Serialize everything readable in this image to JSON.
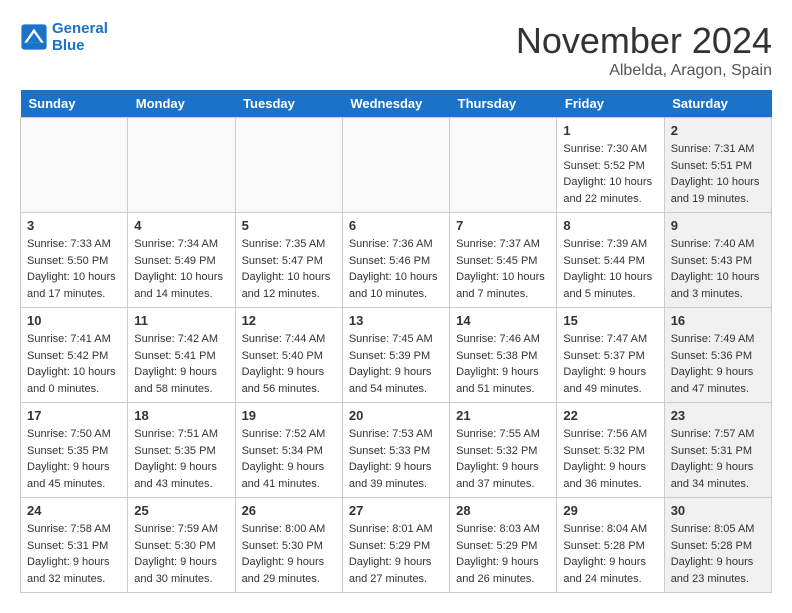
{
  "logo": {
    "line1": "General",
    "line2": "Blue"
  },
  "title": "November 2024",
  "location": "Albelda, Aragon, Spain",
  "days_of_week": [
    "Sunday",
    "Monday",
    "Tuesday",
    "Wednesday",
    "Thursday",
    "Friday",
    "Saturday"
  ],
  "weeks": [
    [
      {
        "day": "",
        "info": "",
        "empty": true
      },
      {
        "day": "",
        "info": "",
        "empty": true
      },
      {
        "day": "",
        "info": "",
        "empty": true
      },
      {
        "day": "",
        "info": "",
        "empty": true
      },
      {
        "day": "",
        "info": "",
        "empty": true
      },
      {
        "day": "1",
        "info": "Sunrise: 7:30 AM\nSunset: 5:52 PM\nDaylight: 10 hours\nand 22 minutes.",
        "empty": false,
        "shaded": false
      },
      {
        "day": "2",
        "info": "Sunrise: 7:31 AM\nSunset: 5:51 PM\nDaylight: 10 hours\nand 19 minutes.",
        "empty": false,
        "shaded": true
      }
    ],
    [
      {
        "day": "3",
        "info": "Sunrise: 7:33 AM\nSunset: 5:50 PM\nDaylight: 10 hours\nand 17 minutes.",
        "empty": false,
        "shaded": false
      },
      {
        "day": "4",
        "info": "Sunrise: 7:34 AM\nSunset: 5:49 PM\nDaylight: 10 hours\nand 14 minutes.",
        "empty": false,
        "shaded": false
      },
      {
        "day": "5",
        "info": "Sunrise: 7:35 AM\nSunset: 5:47 PM\nDaylight: 10 hours\nand 12 minutes.",
        "empty": false,
        "shaded": false
      },
      {
        "day": "6",
        "info": "Sunrise: 7:36 AM\nSunset: 5:46 PM\nDaylight: 10 hours\nand 10 minutes.",
        "empty": false,
        "shaded": false
      },
      {
        "day": "7",
        "info": "Sunrise: 7:37 AM\nSunset: 5:45 PM\nDaylight: 10 hours\nand 7 minutes.",
        "empty": false,
        "shaded": false
      },
      {
        "day": "8",
        "info": "Sunrise: 7:39 AM\nSunset: 5:44 PM\nDaylight: 10 hours\nand 5 minutes.",
        "empty": false,
        "shaded": false
      },
      {
        "day": "9",
        "info": "Sunrise: 7:40 AM\nSunset: 5:43 PM\nDaylight: 10 hours\nand 3 minutes.",
        "empty": false,
        "shaded": true
      }
    ],
    [
      {
        "day": "10",
        "info": "Sunrise: 7:41 AM\nSunset: 5:42 PM\nDaylight: 10 hours\nand 0 minutes.",
        "empty": false,
        "shaded": false
      },
      {
        "day": "11",
        "info": "Sunrise: 7:42 AM\nSunset: 5:41 PM\nDaylight: 9 hours\nand 58 minutes.",
        "empty": false,
        "shaded": false
      },
      {
        "day": "12",
        "info": "Sunrise: 7:44 AM\nSunset: 5:40 PM\nDaylight: 9 hours\nand 56 minutes.",
        "empty": false,
        "shaded": false
      },
      {
        "day": "13",
        "info": "Sunrise: 7:45 AM\nSunset: 5:39 PM\nDaylight: 9 hours\nand 54 minutes.",
        "empty": false,
        "shaded": false
      },
      {
        "day": "14",
        "info": "Sunrise: 7:46 AM\nSunset: 5:38 PM\nDaylight: 9 hours\nand 51 minutes.",
        "empty": false,
        "shaded": false
      },
      {
        "day": "15",
        "info": "Sunrise: 7:47 AM\nSunset: 5:37 PM\nDaylight: 9 hours\nand 49 minutes.",
        "empty": false,
        "shaded": false
      },
      {
        "day": "16",
        "info": "Sunrise: 7:49 AM\nSunset: 5:36 PM\nDaylight: 9 hours\nand 47 minutes.",
        "empty": false,
        "shaded": true
      }
    ],
    [
      {
        "day": "17",
        "info": "Sunrise: 7:50 AM\nSunset: 5:35 PM\nDaylight: 9 hours\nand 45 minutes.",
        "empty": false,
        "shaded": false
      },
      {
        "day": "18",
        "info": "Sunrise: 7:51 AM\nSunset: 5:35 PM\nDaylight: 9 hours\nand 43 minutes.",
        "empty": false,
        "shaded": false
      },
      {
        "day": "19",
        "info": "Sunrise: 7:52 AM\nSunset: 5:34 PM\nDaylight: 9 hours\nand 41 minutes.",
        "empty": false,
        "shaded": false
      },
      {
        "day": "20",
        "info": "Sunrise: 7:53 AM\nSunset: 5:33 PM\nDaylight: 9 hours\nand 39 minutes.",
        "empty": false,
        "shaded": false
      },
      {
        "day": "21",
        "info": "Sunrise: 7:55 AM\nSunset: 5:32 PM\nDaylight: 9 hours\nand 37 minutes.",
        "empty": false,
        "shaded": false
      },
      {
        "day": "22",
        "info": "Sunrise: 7:56 AM\nSunset: 5:32 PM\nDaylight: 9 hours\nand 36 minutes.",
        "empty": false,
        "shaded": false
      },
      {
        "day": "23",
        "info": "Sunrise: 7:57 AM\nSunset: 5:31 PM\nDaylight: 9 hours\nand 34 minutes.",
        "empty": false,
        "shaded": true
      }
    ],
    [
      {
        "day": "24",
        "info": "Sunrise: 7:58 AM\nSunset: 5:31 PM\nDaylight: 9 hours\nand 32 minutes.",
        "empty": false,
        "shaded": false
      },
      {
        "day": "25",
        "info": "Sunrise: 7:59 AM\nSunset: 5:30 PM\nDaylight: 9 hours\nand 30 minutes.",
        "empty": false,
        "shaded": false
      },
      {
        "day": "26",
        "info": "Sunrise: 8:00 AM\nSunset: 5:30 PM\nDaylight: 9 hours\nand 29 minutes.",
        "empty": false,
        "shaded": false
      },
      {
        "day": "27",
        "info": "Sunrise: 8:01 AM\nSunset: 5:29 PM\nDaylight: 9 hours\nand 27 minutes.",
        "empty": false,
        "shaded": false
      },
      {
        "day": "28",
        "info": "Sunrise: 8:03 AM\nSunset: 5:29 PM\nDaylight: 9 hours\nand 26 minutes.",
        "empty": false,
        "shaded": false
      },
      {
        "day": "29",
        "info": "Sunrise: 8:04 AM\nSunset: 5:28 PM\nDaylight: 9 hours\nand 24 minutes.",
        "empty": false,
        "shaded": false
      },
      {
        "day": "30",
        "info": "Sunrise: 8:05 AM\nSunset: 5:28 PM\nDaylight: 9 hours\nand 23 minutes.",
        "empty": false,
        "shaded": true
      }
    ]
  ]
}
